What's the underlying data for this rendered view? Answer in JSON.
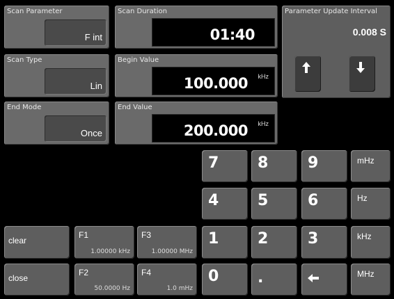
{
  "scan_parameter": {
    "label": "Scan Parameter",
    "value": "F int"
  },
  "scan_type": {
    "label": "Scan Type",
    "value": "Lin"
  },
  "end_mode": {
    "label": "End Mode",
    "value": "Once"
  },
  "scan_duration": {
    "label": "Scan Duration",
    "value": "01:40"
  },
  "begin_value": {
    "label": "Begin Value",
    "value": "100.000",
    "unit": "kHz"
  },
  "end_value": {
    "label": "End Value",
    "value": "200.000",
    "unit": "kHz"
  },
  "update_interval": {
    "label": "Parameter Update Interval",
    "value": "0.008 S",
    "up_icon": "arrow-up-icon",
    "down_icon": "arrow-down-icon"
  },
  "keypad": {
    "keys": [
      "7",
      "8",
      "9",
      "mHz",
      "4",
      "5",
      "6",
      "Hz",
      "1",
      "2",
      "3",
      "kHz",
      "0",
      "."
    ],
    "backspace_icon": "arrow-left-icon",
    "mhz_big": "MHz"
  },
  "actions": {
    "clear": "clear",
    "close": "close"
  },
  "presets": [
    {
      "label": "F1",
      "value": "1.00000 kHz"
    },
    {
      "label": "F3",
      "value": "1.00000 MHz"
    },
    {
      "label": "F2",
      "value": "50.0000 Hz"
    },
    {
      "label": "F4",
      "value": "1.0 mHz"
    }
  ]
}
